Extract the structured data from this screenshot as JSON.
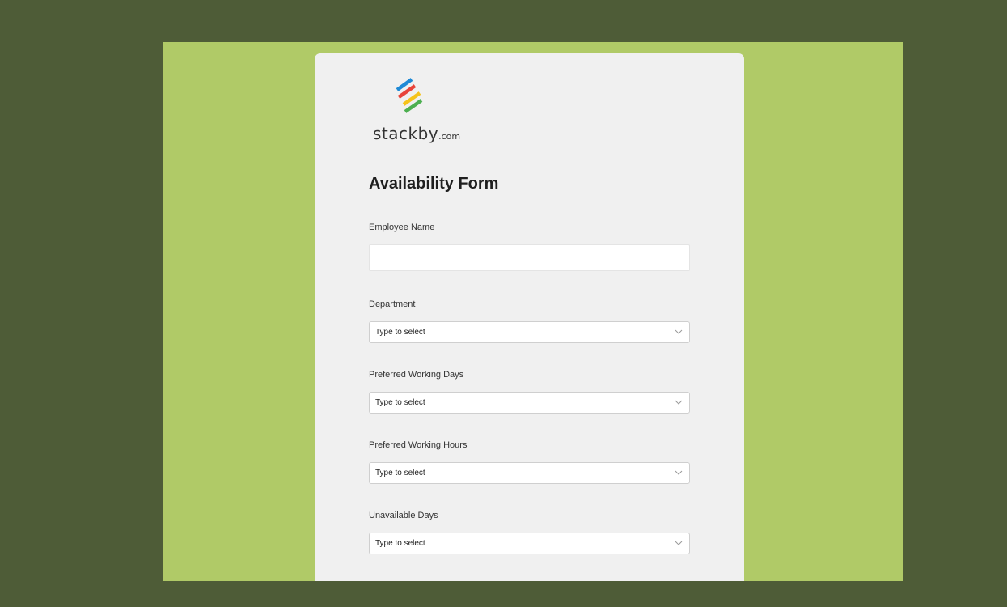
{
  "brand": {
    "name": "stackby",
    "tld": ".com",
    "colors": [
      "#1f8ad6",
      "#e8443a",
      "#f5c31c",
      "#4caf50"
    ]
  },
  "form": {
    "title": "Availability Form",
    "fields": [
      {
        "label": "Employee Name",
        "type": "text",
        "value": ""
      },
      {
        "label": "Department",
        "type": "select",
        "placeholder": "Type to select"
      },
      {
        "label": "Preferred Working Days",
        "type": "select",
        "placeholder": "Type to select"
      },
      {
        "label": "Preferred Working Hours",
        "type": "select",
        "placeholder": "Type to select"
      },
      {
        "label": "Unavailable Days",
        "type": "select",
        "placeholder": "Type to select"
      }
    ]
  },
  "icons": {
    "dropdown": "chevron-down-icon",
    "logo": "stackby-logo-icon"
  },
  "colors": {
    "page_background": "#4e5c37",
    "frame_background": "#b0ca67",
    "card_background": "#f0f0f0"
  }
}
